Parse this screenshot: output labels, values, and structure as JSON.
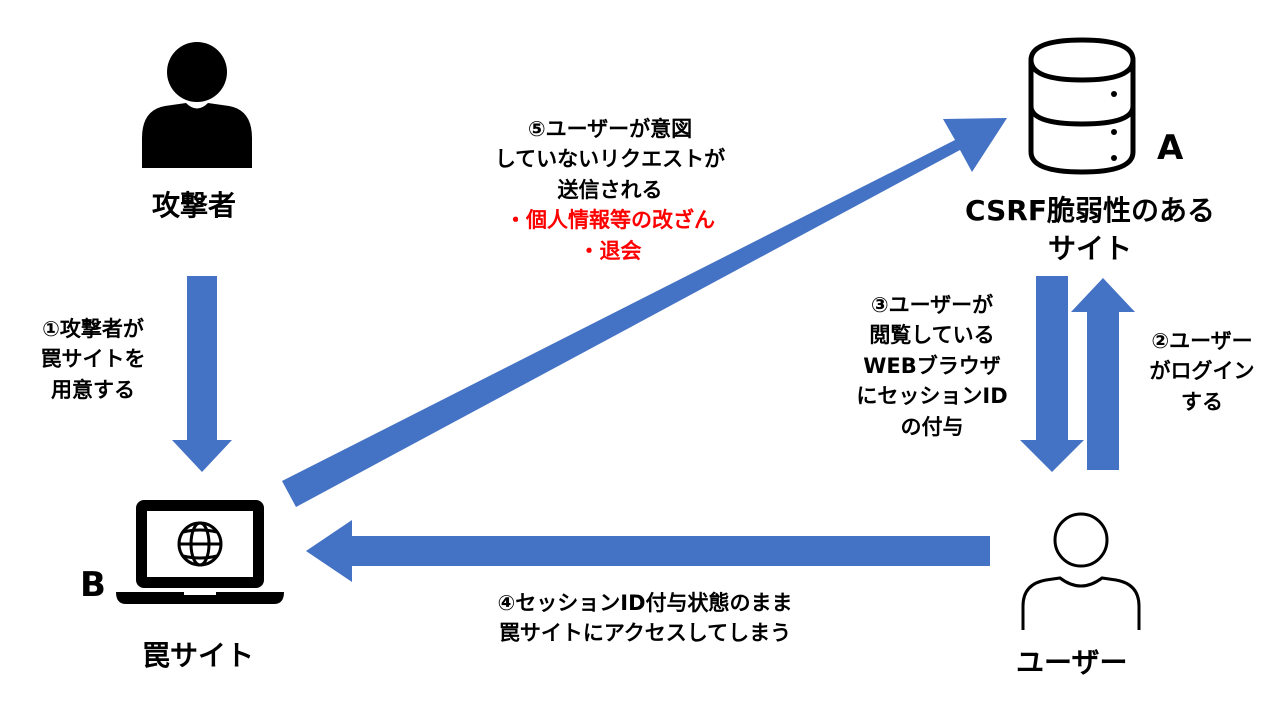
{
  "nodes": {
    "attacker": {
      "label": "攻撃者",
      "icon": "person-filled-icon"
    },
    "trap_site": {
      "label": "罠サイト",
      "marker": "B",
      "icon": "laptop-globe-icon"
    },
    "vulnerable_site": {
      "label_lines": [
        "CSRF脆弱性のある",
        "サイト"
      ],
      "marker": "A",
      "icon": "database-icon"
    },
    "user": {
      "label": "ユーザー",
      "icon": "person-outline-icon"
    }
  },
  "steps": {
    "s1": {
      "lines": [
        "①攻撃者が",
        "罠サイトを",
        "用意する"
      ]
    },
    "s2": {
      "lines": [
        "②ユーザー",
        "がログイン",
        "する"
      ]
    },
    "s3": {
      "lines": [
        "③ユーザーが",
        "閲覧している",
        "WEBブラウザ",
        "にセッションID",
        "の付与"
      ]
    },
    "s4": {
      "lines": [
        "④セッションID付与状態のまま",
        "罠サイトにアクセスしてしまう"
      ]
    },
    "s5": {
      "lines": [
        "⑤ユーザーが意図",
        "していないリクエストが",
        "送信される"
      ],
      "effects": [
        "・個人情報等の改ざん",
        "・退会"
      ]
    }
  },
  "colors": {
    "arrow": "#4472c4",
    "icon": "#000000",
    "warning_text": "#ff0000"
  }
}
